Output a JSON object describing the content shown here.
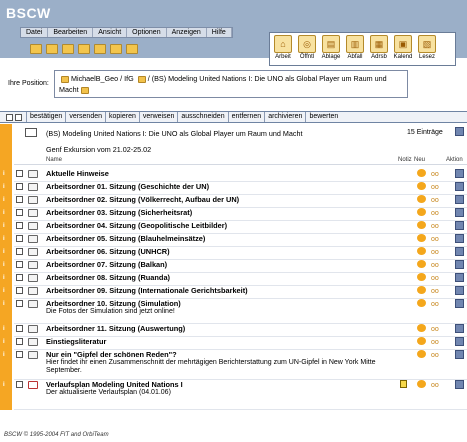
{
  "app": {
    "logo": "BSCW"
  },
  "menu": [
    "Datei",
    "Bearbeiten",
    "Ansicht",
    "Optionen",
    "Anzeigen",
    "Hilfe"
  ],
  "bigtools": [
    {
      "label": "Arbeit",
      "icon": "house-icon"
    },
    {
      "label": "Öffntl",
      "icon": "public-icon"
    },
    {
      "label": "Ablage",
      "icon": "clipboard-icon"
    },
    {
      "label": "Abfall",
      "icon": "trash-icon"
    },
    {
      "label": "Adrsb",
      "icon": "addressbook-icon"
    },
    {
      "label": "Kalend",
      "icon": "calendar-icon"
    },
    {
      "label": "Lesez",
      "icon": "bookmark-icon"
    }
  ],
  "position": {
    "label": "Ihre Position:",
    "path_a": "MichaelB_Geo / IfG",
    "path_b": "/ (BS) Modeling United Nations I: Die UNO als Global Player um Raum und",
    "path_c": "Macht"
  },
  "actions": [
    "bestätigen",
    "versenden",
    "kopieren",
    "verweisen",
    "ausschneiden",
    "entfernen",
    "archivieren",
    "bewerten"
  ],
  "folder": {
    "title": "(BS) Modeling United Nations I: Die UNO als Global Player um Raum und Macht",
    "count": "15 Einträge",
    "subtitle": "Genf Exkursion vom 21.02-25.02"
  },
  "columns": {
    "name": "Name",
    "notiz": "Notiz",
    "neu": "Neu",
    "aktion": "Aktion"
  },
  "rows": [
    {
      "title": "Aktuelle Hinweise",
      "desc": ""
    },
    {
      "title": "Arbeitsordner 01. Sitzung (Geschichte der UN)",
      "desc": ""
    },
    {
      "title": "Arbeitsordner 02. Sitzung (Völkerrecht, Aufbau der UN)",
      "desc": ""
    },
    {
      "title": "Arbeitsordner 03. Sitzung (Sicherheitsrat)",
      "desc": ""
    },
    {
      "title": "Arbeitsordner 04. Sitzung (Geopolitische Leitbilder)",
      "desc": ""
    },
    {
      "title": "Arbeitsordner 05. Sitzung (Blauhelmeinsätze)",
      "desc": ""
    },
    {
      "title": "Arbeitsordner 06. Sitzung (UNHCR)",
      "desc": ""
    },
    {
      "title": "Arbeitsordner 07. Sitzung (Balkan)",
      "desc": ""
    },
    {
      "title": "Arbeitsordner 08. Sitzung (Ruanda)",
      "desc": ""
    },
    {
      "title": "Arbeitsordner 09. Sitzung (Internationale Gerichtsbarkeit)",
      "desc": ""
    },
    {
      "title": "Arbeitsordner 10. Sitzung (Simulation)",
      "desc": "Die Fotos der Simulation sind jetzt online!"
    },
    {
      "title": "Arbeitsordner 11. Sitzung (Auswertung)",
      "desc": ""
    },
    {
      "title": "Einstiegsliteratur",
      "desc": ""
    },
    {
      "title": "Nur ein \"Gipfel der schönen Reden\"?",
      "desc": "Hier findet ihr einen Zusammenschnitt der mehrtägigen Berichterstattung zum UN-Gipfel in New York Mitte September."
    },
    {
      "title": "Verlaufsplan Modeling United Nations I",
      "desc": "Der aktualisierte Verlaufsplan (04.01.06)"
    }
  ],
  "footer": "BSCW © 1995-2004 FIT and OrbiTeam"
}
